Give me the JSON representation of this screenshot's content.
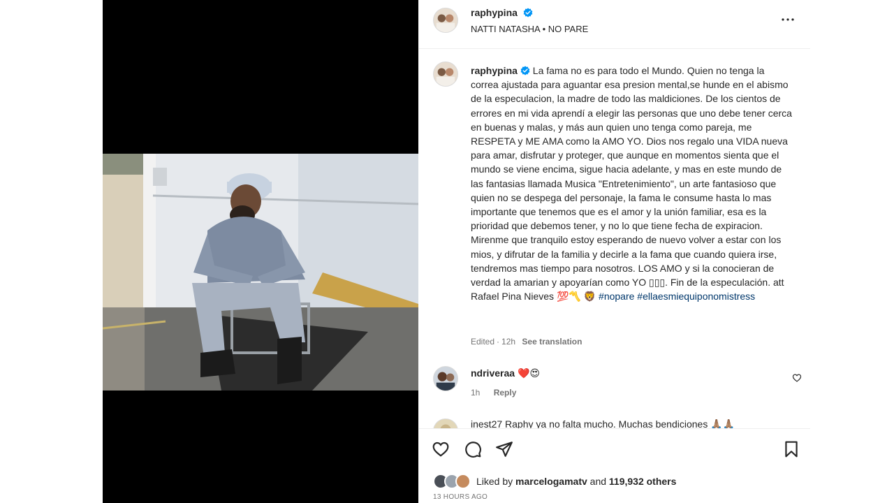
{
  "post": {
    "username": "raphypina",
    "audio": "NATTI NATASHA • NO PARE"
  },
  "caption": {
    "username": "raphypina",
    "text": "La fama no es para todo el Mundo. Quien no tenga la correa ajustada para aguantar esa presion mental,se hunde en el abismo de la especulacion, la madre de todo las maldiciones. De los cientos de errores en mi vida aprendí a elegir las personas que uno debe tener cerca en buenas y malas, y más aun quien uno tenga como pareja, me RESPETA y ME AMA como la AMO YO. Dios nos regalo una VIDA nueva para amar, disfrutar y proteger, que aunque en momentos sienta que el mundo se viene encima, sigue hacia adelante, y mas en este mundo de las fantasias llamada Musica \"Entretenimiento\", un arte fantasioso que quien no se despega del personaje, la fama le consume hasta lo mas importante que tenemos que es el amor y la unión familiar, esa es la prioridad que debemos tener, y no lo que tiene fecha de expiracion. Mirenme que tranquilo estoy esperando de nuevo volver a estar con los mios, y difrutar de la familia y decirle a la fama que cuando quiera irse, tendremos mas tiempo para nosotros. LOS AMO y si la conocieran de verdad la amarian y apoyarían como YO ▯▯▯. Fin de la especulación. att Rafael Pina Nieves 💯〽️ 🦁",
    "hashtags": "#nopare #ellaesmiequiponomistress",
    "edited": "Edited",
    "age": "12h",
    "see_translation": "See translation"
  },
  "comments": [
    {
      "username": "ndriveraa",
      "text": "❤️😍",
      "age": "1h",
      "reply": "Reply"
    }
  ],
  "partial_comment": {
    "text": "inest27 Raphy ya no falta mucho. Muchas bendiciones 🙏🏽🙏🏽"
  },
  "likes": {
    "prefix": "Liked by",
    "user": "marcelogamatv",
    "middle": "and",
    "count": "119,932 others"
  },
  "time_ago": "13 HOURS AGO",
  "icons": {
    "more": "more-horizontal-icon",
    "like": "heart-icon",
    "comment": "comment-icon",
    "share": "share-icon",
    "save": "bookmark-icon",
    "verified": "verified-badge-icon"
  },
  "colors": {
    "verified": "#0095f6",
    "text": "#262626",
    "secondary": "#737373",
    "hashtag": "#00376b",
    "divider": "#efefef"
  }
}
